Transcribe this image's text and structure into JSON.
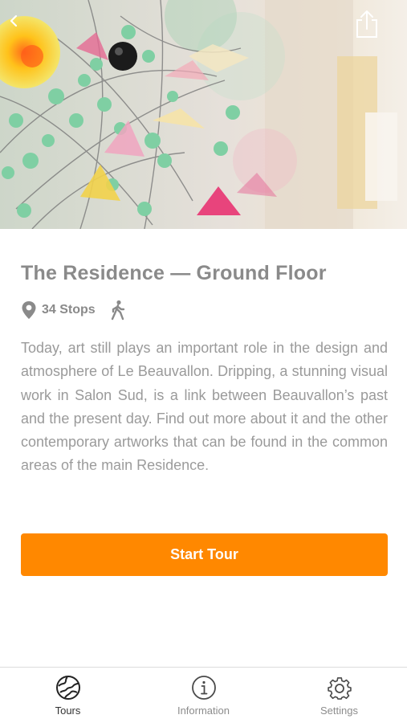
{
  "hero": {
    "back_icon": "chevron-left-icon",
    "share_icon": "share-icon"
  },
  "tour": {
    "title": "The Residence — Ground Floor",
    "stops_label": "34 Stops",
    "stops_icon": "location-pin-icon",
    "mode_icon": "walking-person-icon",
    "description": "Today, art still plays an important role in the design and atmosphere of Le Beauvallon. Dripping, a stunning visual work in Salon Sud, is a link between Beauvallon’s past and the present day. Find out more about it and the other contemporary artworks that can be found in the common areas of the main Residence."
  },
  "actions": {
    "start_label": "Start Tour",
    "accent_color": "#ff8800"
  },
  "tabbar": {
    "tabs": [
      {
        "label": "Tours",
        "icon": "globe-icon",
        "active": true
      },
      {
        "label": "Information",
        "icon": "info-icon",
        "active": false
      },
      {
        "label": "Settings",
        "icon": "gear-icon",
        "active": false
      }
    ]
  }
}
